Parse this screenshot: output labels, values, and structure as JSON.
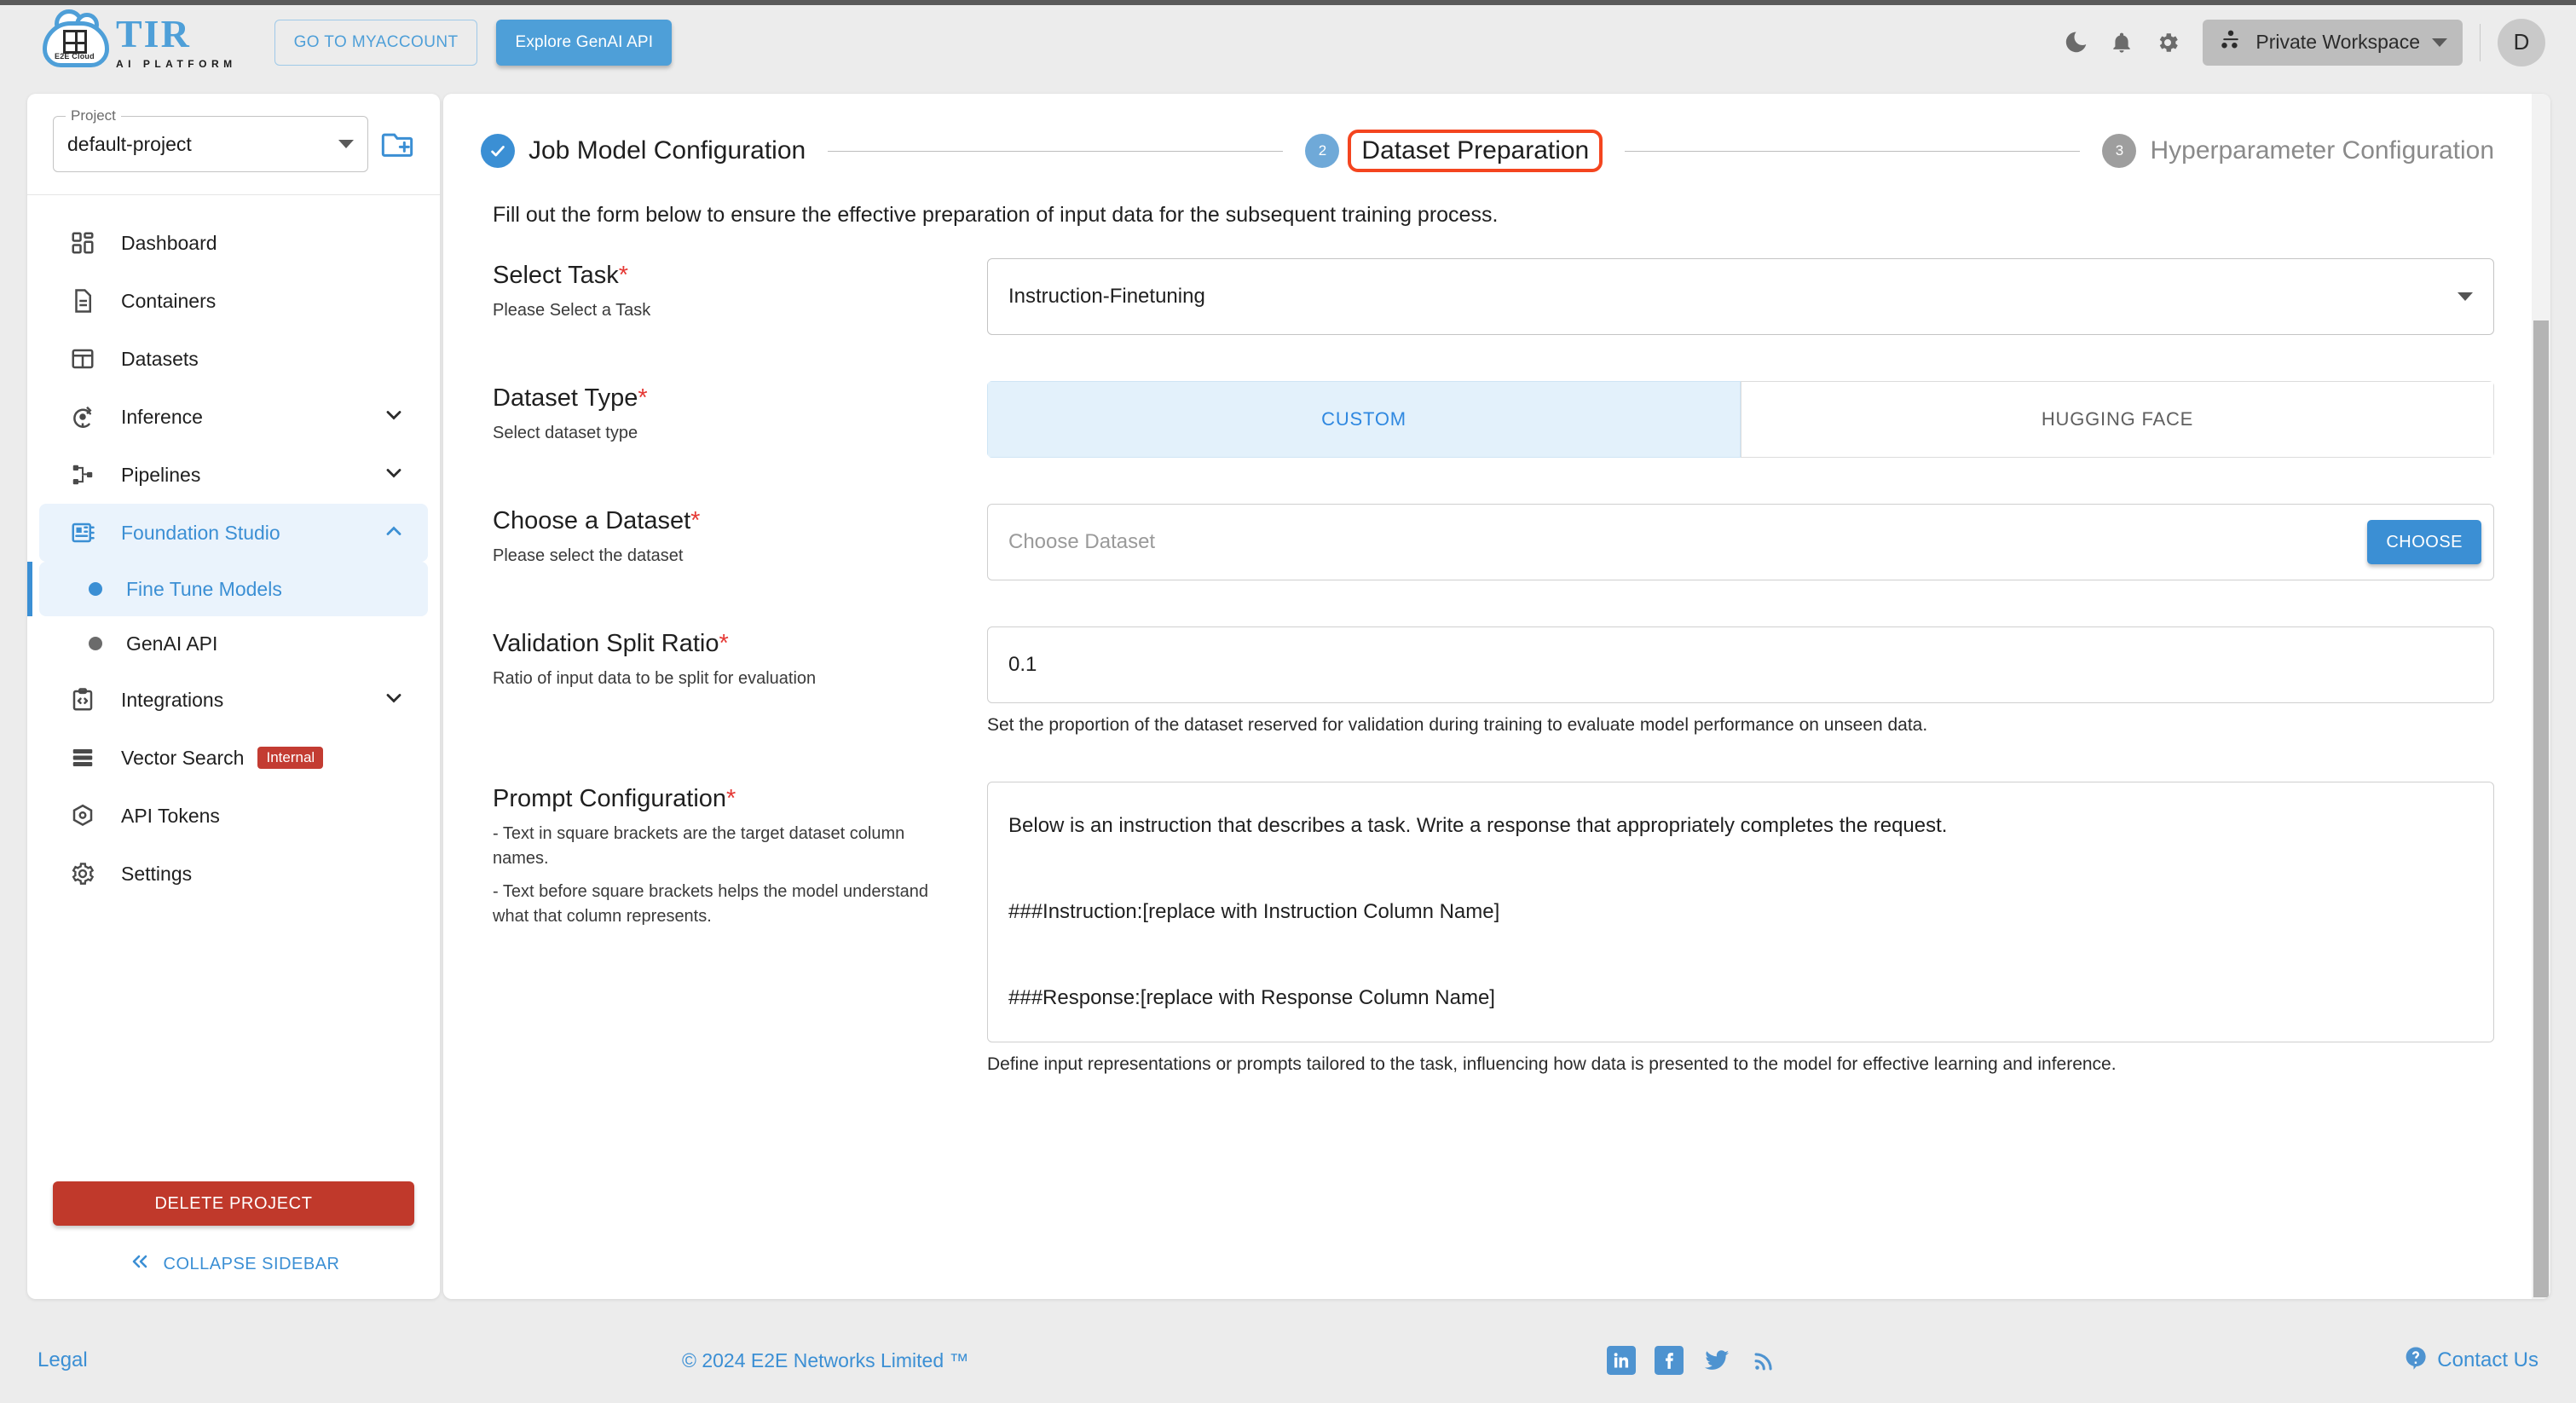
{
  "topbar": {
    "logo_tir": "TIR",
    "logo_sub": "AI PLATFORM",
    "logo_cloud_label": "E2E Cloud",
    "myaccount_label": "GO TO MYACCOUNT",
    "genai_label": "Explore GenAI API",
    "workspace_label": "Private Workspace",
    "avatar_initial": "D",
    "icons": {
      "dark_mode": "moon-icon",
      "notifications": "bell-icon",
      "settings": "gear-icon",
      "workspace": "workspace-nodes-icon",
      "chevron": "chevron-down-icon"
    }
  },
  "sidebar": {
    "project_legend": "Project",
    "project_value": "default-project",
    "new_project_icon": "folder-plus-icon",
    "items": [
      {
        "label": "Dashboard",
        "icon": "dashboard-icon",
        "expandable": false,
        "active": false
      },
      {
        "label": "Containers",
        "icon": "document-icon",
        "expandable": false,
        "active": false
      },
      {
        "label": "Datasets",
        "icon": "grid-table-icon",
        "expandable": false,
        "active": false
      },
      {
        "label": "Inference",
        "icon": "inference-icon",
        "expandable": true,
        "active": false
      },
      {
        "label": "Pipelines",
        "icon": "pipelines-icon",
        "expandable": true,
        "active": false
      },
      {
        "label": "Foundation Studio",
        "icon": "studio-icon",
        "expandable": true,
        "active": true
      }
    ],
    "sub_items": [
      {
        "label": "Fine Tune Models",
        "active": true
      },
      {
        "label": "GenAI API",
        "active": false
      }
    ],
    "items_after": [
      {
        "label": "Integrations",
        "icon": "code-clipboard-icon",
        "expandable": true,
        "badge": ""
      },
      {
        "label": "Vector Search",
        "icon": "server-stack-icon",
        "expandable": false,
        "badge": "Internal"
      },
      {
        "label": "API Tokens",
        "icon": "cube-icon",
        "expandable": false,
        "badge": ""
      },
      {
        "label": "Settings",
        "icon": "gear-icon",
        "expandable": false,
        "badge": ""
      }
    ],
    "delete_label": "DELETE PROJECT",
    "collapse_label": "COLLAPSE SIDEBAR",
    "collapse_icon": "double-chevron-left-icon"
  },
  "stepper": {
    "steps": [
      {
        "num": "1",
        "label": "Job Model Configuration",
        "state": "done"
      },
      {
        "num": "2",
        "label": "Dataset Preparation",
        "state": "current"
      },
      {
        "num": "3",
        "label": "Hyperparameter Configuration",
        "state": "todo"
      }
    ],
    "highlight_color": "#f4451f"
  },
  "main": {
    "intro": "Fill out the form below to ensure the effective preparation of input data for the subsequent training process.",
    "select_task": {
      "title": "Select Task",
      "required": "*",
      "subtitle": "Please Select a Task",
      "value": "Instruction-Finetuning",
      "caret_icon": "chevron-down-icon"
    },
    "dataset_type": {
      "title": "Dataset Type",
      "required": "*",
      "subtitle": "Select dataset type",
      "options": [
        {
          "label": "CUSTOM",
          "selected": true
        },
        {
          "label": "HUGGING FACE",
          "selected": false
        }
      ]
    },
    "choose_dataset": {
      "title": "Choose a Dataset",
      "required": "*",
      "subtitle": "Please select the dataset",
      "placeholder": "Choose Dataset",
      "button_label": "CHOOSE"
    },
    "validation_split": {
      "title": "Validation Split Ratio",
      "required": "*",
      "subtitle": "Ratio of input data to be split for evaluation",
      "value": "0.1",
      "helper": "Set the proportion of the dataset reserved for validation during training to evaluate model performance on unseen data."
    },
    "prompt_config": {
      "title": "Prompt Configuration",
      "required": "*",
      "subtitle_line1": "- Text in square brackets are the target dataset column names.",
      "subtitle_line2": "- Text before square brackets helps the model understand what that column represents.",
      "value": "Below is an instruction that describes a task. Write a response that appropriately completes the request.\n\n###Instruction:[replace with Instruction Column Name]\n\n###Response:[replace with Response Column Name]",
      "helper": "Define input representations or prompts tailored to the task, influencing how data is presented to the model for effective learning and inference."
    }
  },
  "footer": {
    "legal": "Legal",
    "copyright": "© 2024 E2E Networks Limited ™",
    "social": [
      "linkedin-icon",
      "facebook-icon",
      "twitter-icon",
      "rss-icon"
    ],
    "contact": "Contact Us",
    "contact_icon": "question-circle-icon"
  },
  "colors": {
    "brand_blue": "#3b8fd4",
    "accent_red": "#c0392b",
    "highlight": "#f4451f",
    "page_bg": "#ececec"
  }
}
